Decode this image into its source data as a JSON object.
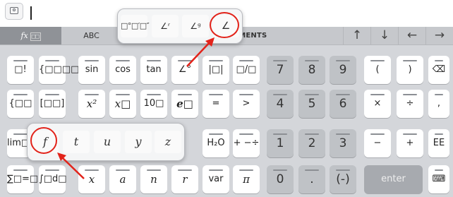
{
  "input": {
    "value": ""
  },
  "categories": {
    "fx_label": "fx",
    "fx_sub": "□□",
    "abc_label": "ABC",
    "arguments_label": "RUMENTS"
  },
  "nav_arrows": {
    "up": "↑",
    "down": "↓",
    "left": "←",
    "right": "→"
  },
  "rows": [
    [
      "□!",
      "{□□□□",
      "sin",
      "cos",
      "tan",
      "∠°",
      "|□|",
      "□/□",
      "7",
      "8",
      "9",
      "(",
      ")",
      "⌫"
    ],
    [
      "{□□",
      "[□□]",
      "x²",
      "x□",
      "10□",
      "e□",
      "=",
      ">",
      "4",
      "5",
      "6",
      "×",
      "÷",
      ","
    ],
    [
      "lim□→□",
      "",
      "",
      "",
      "",
      "",
      "",
      "H₂O",
      "+ −÷ ×",
      "1",
      "2",
      "3",
      "−",
      "+",
      "EE"
    ],
    [
      "∑□=□",
      "∫□d□",
      "x",
      "a",
      "n",
      "r",
      "var",
      "π",
      "0",
      ".",
      "(-)",
      "enter",
      "⌨"
    ]
  ],
  "angle_popup": {
    "items": [
      "□°□′□″",
      "∠ʳ",
      "∠ᵍ",
      "∠"
    ]
  },
  "variable_popup": {
    "items": [
      "f",
      "t",
      "u",
      "y",
      "z"
    ]
  },
  "annotation_color": "#e2231a"
}
